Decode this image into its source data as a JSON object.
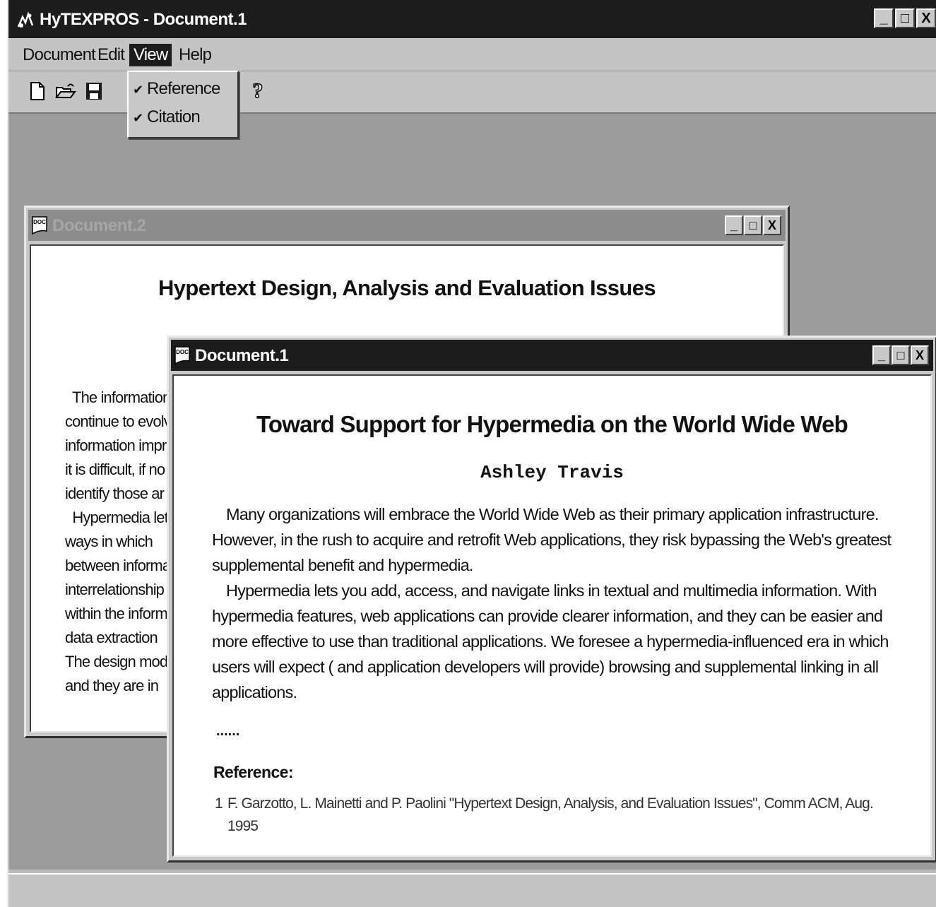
{
  "app": {
    "title": "HyTEXPROS - Document.1",
    "window_buttons": {
      "minimize": "_",
      "maximize": "□",
      "close": "X"
    }
  },
  "menubar": {
    "items": [
      {
        "label": "Document"
      },
      {
        "label": "Edit"
      },
      {
        "label": "View",
        "active": true
      },
      {
        "label": "Help"
      }
    ]
  },
  "view_menu": {
    "items": [
      {
        "label": "Reference",
        "checked": true
      },
      {
        "label": "Citation",
        "checked": true
      }
    ],
    "check_glyph": "✔"
  },
  "toolbar": {
    "icons": [
      "new-document-icon",
      "open-folder-icon",
      "save-icon",
      "help-icon"
    ],
    "help_glyph": "?"
  },
  "doc2": {
    "title": "Document.2",
    "heading": "Hypertext Design, Analysis and Evaluation Issues",
    "lines": [
      "  The information",
      "continue to evolv",
      "information impro",
      "it is difficult, if no",
      "identify those ar",
      "  Hypermedia let",
      "ways in which",
      "between informa",
      "interrelationship",
      "within the inform",
      "data extraction",
      "The design mode",
      "and they are in"
    ]
  },
  "doc1": {
    "title": "Document.1",
    "heading": "Toward Support for Hypermedia on the World Wide Web",
    "author": "Ashley Travis",
    "paragraphs": [
      "Many organizations will embrace the World Wide Web as their primary application infrastructure. However, in the rush to acquire and retrofit  Web applications, they risk bypassing the Web's greatest supplemental benefit and hypermedia.",
      "Hypermedia lets you add, access, and navigate links in textual and multimedia information. With hypermedia features, web applications can provide clearer information, and they can be easier and more effective to use than traditional applications. We foresee a hypermedia-influenced era in which users will expect ( and application developers will provide) browsing and supplemental linking in all applications."
    ],
    "ellipsis": "......",
    "reference_heading": "Reference:",
    "references": [
      {
        "number": "1",
        "text": "F. Garzotto, L. Mainetti and P. Paolini  \"Hypertext Design, Analysis, and Evaluation Issues\", Comm ACM, Aug. 1995"
      }
    ]
  }
}
